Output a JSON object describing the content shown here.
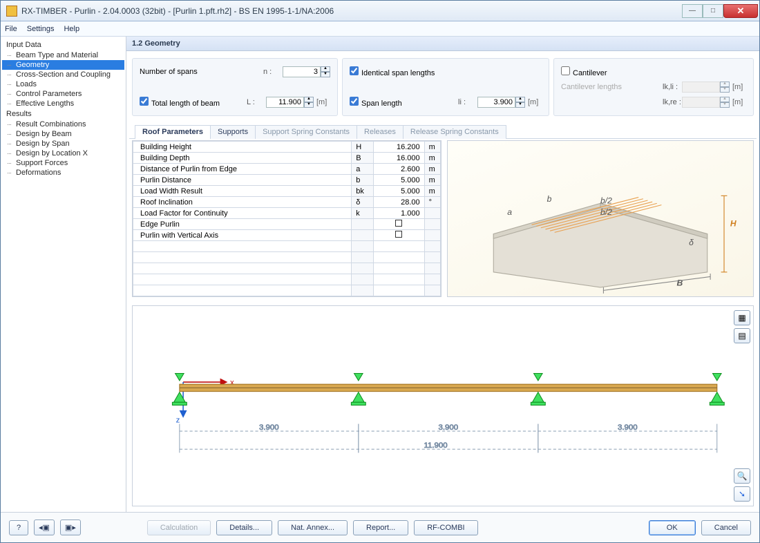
{
  "window": {
    "title": "RX-TIMBER - Purlin - 2.04.0003 (32bit) - [Purlin 1.pft.rh2] - BS EN 1995-1-1/NA:2006"
  },
  "menu": {
    "file": "File",
    "settings": "Settings",
    "help": "Help"
  },
  "nav": {
    "input_header": "Input Data",
    "input": [
      "Beam Type and Material",
      "Geometry",
      "Cross-Section and Coupling",
      "Loads",
      "Control Parameters",
      "Effective Lengths"
    ],
    "results_header": "Results",
    "results": [
      "Result Combinations",
      "Design by Beam",
      "Design by Span",
      "Design by Location X",
      "Support Forces",
      "Deformations"
    ],
    "selected": "Geometry"
  },
  "section_title": "1.2 Geometry",
  "spans": {
    "num_label": "Number of spans",
    "num_sym": "n :",
    "num_val": "3",
    "total_label": "Total length of beam",
    "total_sym": "L :",
    "total_val": "11.900",
    "total_unit": "[m]",
    "identical_label": "Identical span lengths",
    "span_label": "Span length",
    "span_sym": "li :",
    "span_val": "3.900",
    "span_unit": "[m]"
  },
  "cantilever": {
    "title": "Cantilever",
    "len_label": "Cantilever lengths",
    "left_sym": "lk,li :",
    "left_unit": "[m]",
    "right_sym": "lk,re :",
    "right_unit": "[m]"
  },
  "tabs": [
    "Roof Parameters",
    "Supports",
    "Support Spring Constants",
    "Releases",
    "Release Spring Constants"
  ],
  "active_tab": "Roof Parameters",
  "roof_params": [
    {
      "name": "Building Height",
      "sym": "H",
      "val": "16.200",
      "unit": "m"
    },
    {
      "name": "Building Depth",
      "sym": "B",
      "val": "16.000",
      "unit": "m"
    },
    {
      "name": "Distance of Purlin from Edge",
      "sym": "a",
      "val": "2.600",
      "unit": "m"
    },
    {
      "name": "Purlin Distance",
      "sym": "b",
      "val": "5.000",
      "unit": "m"
    },
    {
      "name": "Load Width Result",
      "sym": "bk",
      "val": "5.000",
      "unit": "m"
    },
    {
      "name": "Roof Inclination",
      "sym": "δ",
      "val": "28.00",
      "unit": "°"
    },
    {
      "name": "Load Factor for Continuity",
      "sym": "k",
      "val": "1.000",
      "unit": ""
    },
    {
      "name": "Edge Purlin",
      "sym": "",
      "val": "",
      "unit": "",
      "checkbox": true
    },
    {
      "name": "Purlin with Vertical Axis",
      "sym": "",
      "val": "",
      "unit": "",
      "checkbox": true
    }
  ],
  "diagram_labels": {
    "a": "a",
    "b": "b",
    "b2a": "b/2",
    "b2b": "b/2",
    "H": "H",
    "B": "B",
    "delta": "δ"
  },
  "beam": {
    "spans": [
      "3.900",
      "3.900",
      "3.900"
    ],
    "total": "11.900",
    "x": "x",
    "z": "z"
  },
  "footer": {
    "calculation": "Calculation",
    "details": "Details...",
    "natannex": "Nat. Annex...",
    "report": "Report...",
    "rfcombi": "RF-COMBI",
    "ok": "OK",
    "cancel": "Cancel"
  }
}
